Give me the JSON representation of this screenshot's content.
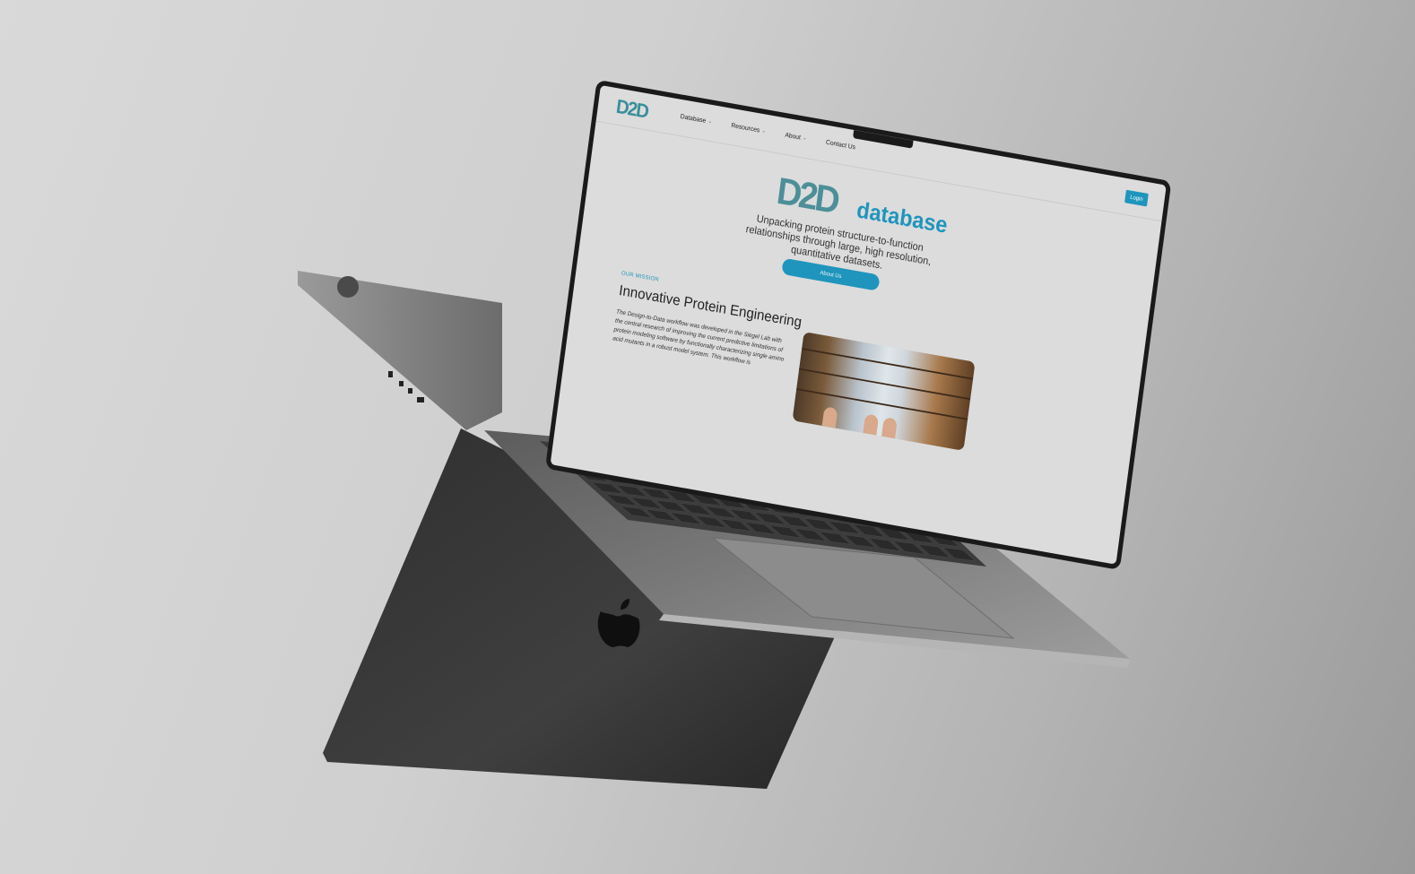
{
  "site": {
    "logo_text": "D2D",
    "nav": [
      {
        "label": "Database",
        "has_dropdown": true
      },
      {
        "label": "Resources",
        "has_dropdown": true
      },
      {
        "label": "About",
        "has_dropdown": true
      },
      {
        "label": "Contact Us",
        "has_dropdown": false
      }
    ],
    "login_label": "Login",
    "hero": {
      "logo_text": "D2D",
      "wordmark": "database",
      "tagline": "Unpacking protein structure-to-function relationships through large, high resolution, quantitative datasets.",
      "about_button": "About Us"
    },
    "mission": {
      "label": "OUR MISSION",
      "title": "Innovative Protein Engineering",
      "body": "The Design-to-Data workflow was developed in the Siegel Lab with the central research of improving the current predictive limitations of protein modeling software by functionally characterizing single amino acid mutants in a robust model system. This workflow is"
    }
  },
  "colors": {
    "accent": "#1f95bd",
    "background": "#d9d9d9",
    "device": "#3a3a3a"
  },
  "icons": {
    "caret": "chevron-down-icon",
    "logo": "apple-logo-icon"
  }
}
